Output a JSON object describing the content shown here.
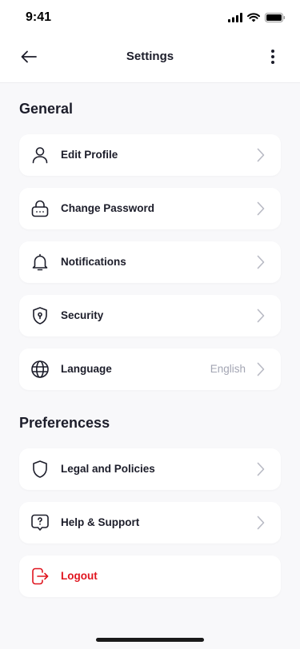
{
  "status_bar": {
    "time": "9:41"
  },
  "header": {
    "title": "Settings"
  },
  "sections": [
    {
      "heading": "General",
      "items": [
        {
          "label": "Edit Profile",
          "icon": "user-icon"
        },
        {
          "label": "Change Password",
          "icon": "lock-icon"
        },
        {
          "label": "Notifications",
          "icon": "bell-icon"
        },
        {
          "label": "Security",
          "icon": "shield-lock-icon"
        },
        {
          "label": "Language",
          "icon": "globe-icon",
          "value": "English"
        }
      ]
    },
    {
      "heading": "Preferencess",
      "items": [
        {
          "label": "Legal and Policies",
          "icon": "shield-icon"
        },
        {
          "label": "Help & Support",
          "icon": "help-chat-icon"
        },
        {
          "label": "Logout",
          "icon": "logout-icon",
          "danger": true
        }
      ]
    }
  ],
  "colors": {
    "background": "#f8f8fa",
    "card": "#ffffff",
    "text": "#1c1d2a",
    "muted": "#a3a5b3",
    "chevron": "#b8bac4",
    "danger": "#e0151f"
  }
}
